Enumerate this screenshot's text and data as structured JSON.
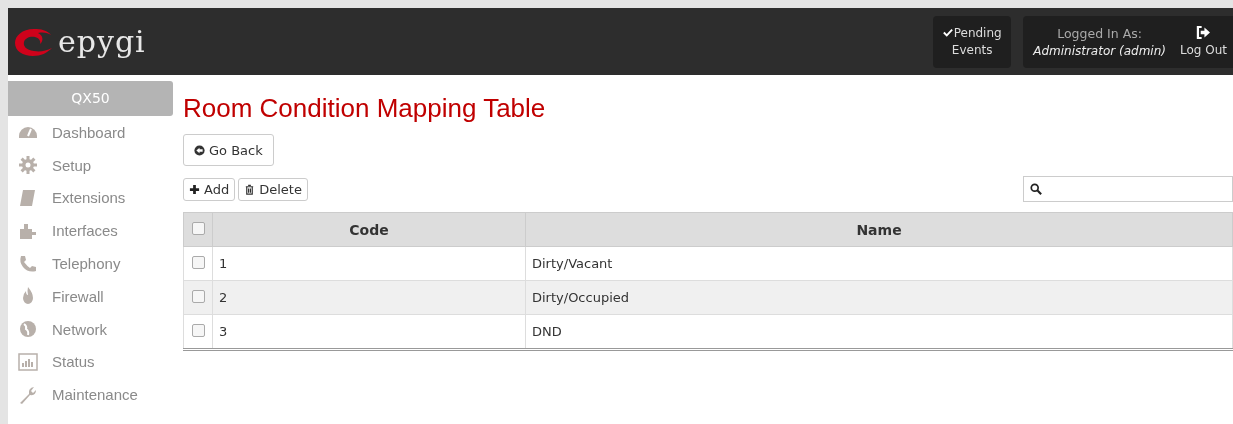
{
  "header": {
    "logo_text": "epygi",
    "pending": "Pending Events",
    "logged_label": "Logged In As:",
    "user": "Administrator (admin)",
    "logout": "Log Out"
  },
  "sidebar": {
    "device": "QX50",
    "items": [
      {
        "label": "Dashboard"
      },
      {
        "label": "Setup"
      },
      {
        "label": "Extensions"
      },
      {
        "label": "Interfaces"
      },
      {
        "label": "Telephony"
      },
      {
        "label": "Firewall"
      },
      {
        "label": "Network"
      },
      {
        "label": "Status"
      },
      {
        "label": "Maintenance"
      }
    ]
  },
  "page": {
    "title": "Room Condition Mapping Table",
    "back": "Go Back",
    "add": "Add",
    "delete": "Delete"
  },
  "table": {
    "select_all_checked": false,
    "columns": [
      "Code",
      "Name"
    ],
    "rows": [
      {
        "checked": false,
        "code": "1",
        "name": "Dirty/Vacant"
      },
      {
        "checked": false,
        "code": "2",
        "name": "Dirty/Occupied"
      },
      {
        "checked": false,
        "code": "3",
        "name": "DND"
      }
    ]
  }
}
